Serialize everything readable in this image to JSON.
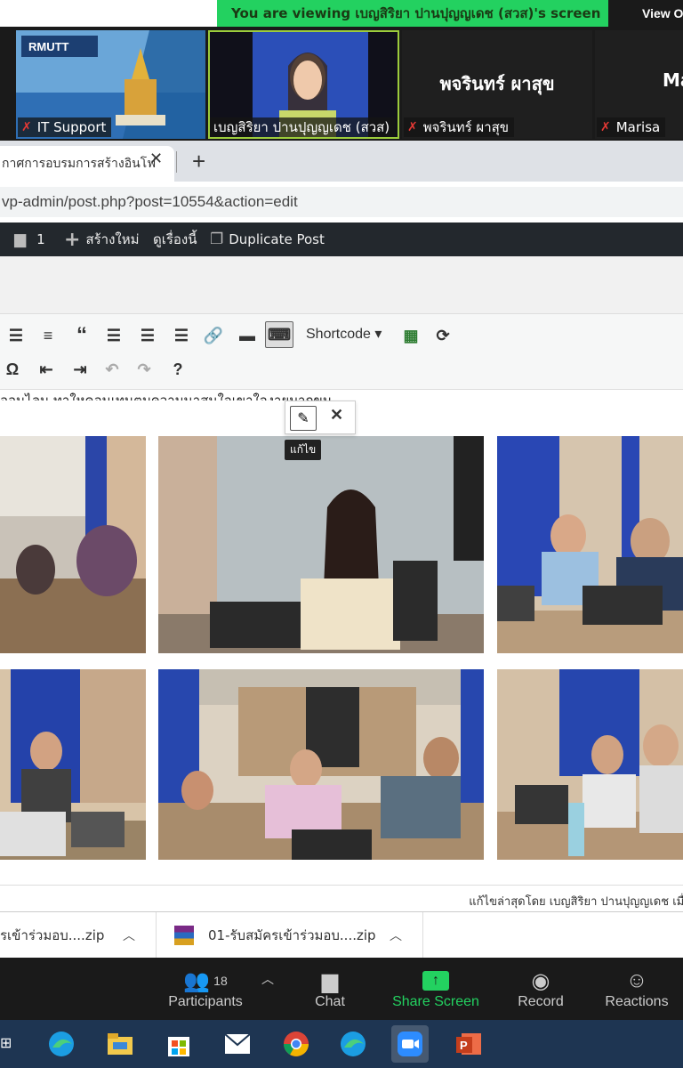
{
  "zoom": {
    "banner_text": "You are viewing เบญสิริยา ปานปุญญเดช (สวส)'s screen",
    "view_options_label": "View O",
    "participants": [
      {
        "label": "IT Support"
      },
      {
        "label": "เบญสิริยา ปานปุญญเดช (สวส)"
      },
      {
        "label": "พจรินทร์ ผาสุข",
        "name": "พจรินทร์ ผาสุข"
      },
      {
        "label": "Marisa",
        "name": "Ma"
      }
    ],
    "controls": {
      "participants_count": "18",
      "participants_label": "Participants",
      "chat_label": "Chat",
      "share_label": "Share Screen",
      "record_label": "Record",
      "reactions_label": "Reactions"
    }
  },
  "browser": {
    "tab_title": "กาศการอบรมการสร้างอินโฟ",
    "url": "vp-admin/post.php?post=10554&action=edit"
  },
  "wp": {
    "comments_count": "1",
    "new_label": "สร้างใหม่",
    "view_label": "ดูเรื่องนี้",
    "duplicate_label": "Duplicate Post",
    "shortcode_label": "Shortcode",
    "content_text": "ออนไลน ทาใหคอนเทนตมความนาสนใจเขาใจงายมากขน",
    "tooltip": "แก้ไข",
    "last_edit": "แก้ไขล่าสุดโดย เบญสิริยา ปานปุญญเดช เมื่อ 5 เ"
  },
  "downloads": {
    "item1": "รเข้าร่วมอบ....zip",
    "item2": "01-รับสมัครเข้าร่วมอบ....zip"
  },
  "colors": {
    "zoom_green": "#23d160",
    "wp_admin_bar": "#23282d",
    "taskbar": "#1e3552"
  }
}
